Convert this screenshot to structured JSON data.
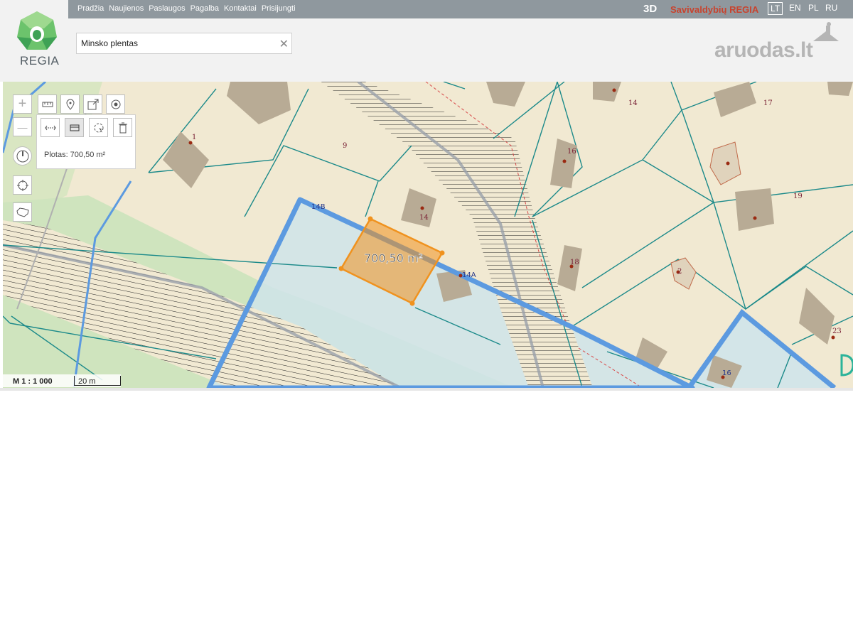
{
  "nav": {
    "items": [
      "Pradžia",
      "Naujienos",
      "Paslaugos",
      "Pagalba",
      "Kontaktai",
      "Prisijungti"
    ],
    "btn_3d": "3D",
    "brand": "Savivaldybių REGIA",
    "languages": [
      "LT",
      "EN",
      "PL",
      "RU"
    ],
    "active_language": "LT"
  },
  "logo": {
    "text": "REGIA"
  },
  "search": {
    "value": "Minsko plentas",
    "clear_icon": "close-icon"
  },
  "partner": {
    "logo_text": "aruodas.lt"
  },
  "tools": {
    "zoom_in": "+",
    "zoom_out": "—",
    "icons": [
      "ruler-icon",
      "pin-icon",
      "share-icon",
      "target-icon",
      "measure-length-icon",
      "measure-area-icon",
      "cursor-icon",
      "trash-icon",
      "compass-icon",
      "locate-icon",
      "lithuania-map-icon"
    ]
  },
  "measure": {
    "readout": "Plotas: 700,50 m²",
    "area_label": "700,50 m²"
  },
  "map_labels": {
    "parcels": [
      "1",
      "9",
      "14",
      "14",
      "16",
      "17",
      "19",
      "18",
      "23",
      "14B",
      "14A",
      "16",
      "2"
    ]
  },
  "scale": {
    "ratio": "M 1 : 1 000",
    "bar": "20 m"
  },
  "colors": {
    "topbar": "#8f989e",
    "brand": "#c8432e",
    "map_bg": "#f1e9d2",
    "parcel_line": "#1c8a8a",
    "highlight_border": "#5c9ae0",
    "selection": "#f0921e",
    "house": "#b8ab95"
  }
}
